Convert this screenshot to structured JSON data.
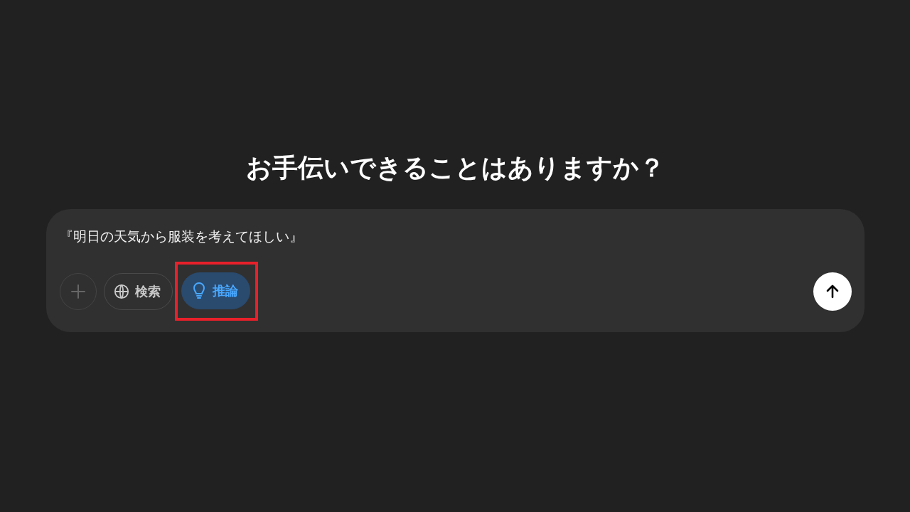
{
  "heading": "お手伝いできることはありますか？",
  "composer": {
    "value": "『明日の天気から服装を考えてほしい』",
    "attach_button": {
      "disabled": true
    },
    "tools": [
      {
        "kind": "search",
        "label": "検索",
        "selected": false,
        "highlighted": false
      },
      {
        "kind": "reason",
        "label": "推論",
        "selected": true,
        "highlighted": true
      }
    ],
    "send_button": {
      "disabled": false
    }
  }
}
